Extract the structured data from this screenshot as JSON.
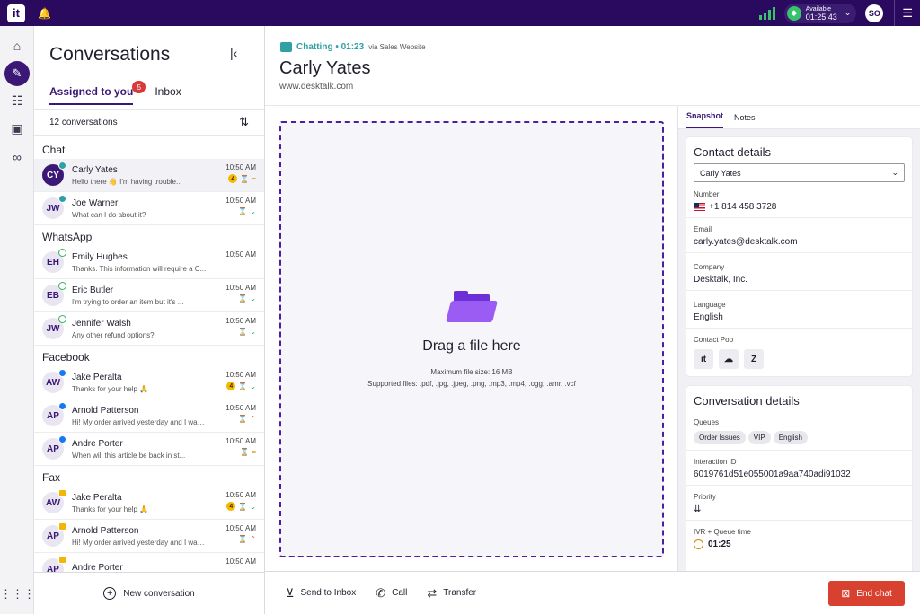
{
  "topbar": {
    "logo": "it",
    "bell_icon": "bell-icon",
    "status_label": "Available",
    "status_time": "01:25:43",
    "user_initials": "SO"
  },
  "rail": {
    "items": [
      "home-icon",
      "conversations-icon",
      "tasks-icon",
      "contacts-icon",
      "voicemail-icon"
    ],
    "apps_icon": "apps-grid-icon"
  },
  "conversations": {
    "title": "Conversations",
    "tabs": [
      {
        "label": "Assigned to you",
        "badge": "5"
      },
      {
        "label": "Inbox"
      }
    ],
    "count_label": "12 conversations",
    "groups": [
      {
        "name": "Chat",
        "items": [
          {
            "initials": "CY",
            "name": "Carly Yates",
            "message": "Hello there 👋 I'm having trouble...",
            "time": "10:50 AM",
            "count": "4",
            "priority": "medium",
            "channel": "chat",
            "active": true
          },
          {
            "initials": "JW",
            "name": "Joe Warner",
            "message": "What can I do about it?",
            "time": "10:50 AM",
            "priority": "low",
            "channel": "chat"
          }
        ]
      },
      {
        "name": "WhatsApp",
        "items": [
          {
            "initials": "EH",
            "name": "Emily Hughes",
            "message": "Thanks. This information will require a C...",
            "time": "10:50 AM",
            "channel": "whatsapp"
          },
          {
            "initials": "EB",
            "name": "Eric Butler",
            "message": "I'm trying to order an item but it's ...",
            "time": "10:50 AM",
            "priority": "low",
            "channel": "whatsapp"
          },
          {
            "initials": "JW",
            "name": "Jennifer Walsh",
            "message": "Any other refund options?",
            "time": "10:50 AM",
            "priority": "low",
            "channel": "whatsapp"
          }
        ]
      },
      {
        "name": "Facebook",
        "items": [
          {
            "initials": "AW",
            "name": "Jake Peralta",
            "message": "Thanks for your help 🙏",
            "time": "10:50 AM",
            "count": "4",
            "priority": "low",
            "channel": "facebook"
          },
          {
            "initials": "AP",
            "name": "Arnold Patterson",
            "message": "Hi! My order arrived yesterday and I was...",
            "time": "10:50 AM",
            "priority": "high",
            "channel": "facebook"
          },
          {
            "initials": "AP",
            "name": "Andre Porter",
            "message": "When will this article be back in st...",
            "time": "10:50 AM",
            "priority": "medium",
            "channel": "facebook"
          }
        ]
      },
      {
        "name": "Fax",
        "items": [
          {
            "initials": "AW",
            "name": "Jake Peralta",
            "message": "Thanks for your help 🙏",
            "time": "10:50 AM",
            "count": "4",
            "priority": "low",
            "channel": "fax"
          },
          {
            "initials": "AP",
            "name": "Arnold Patterson",
            "message": "Hi! My order arrived yesterday and I was...",
            "time": "10:50 AM",
            "priority": "high",
            "channel": "fax"
          },
          {
            "initials": "AP",
            "name": "Andre Porter",
            "message": "",
            "time": "10:50 AM",
            "channel": "fax"
          }
        ]
      }
    ],
    "new_conversation": "New conversation"
  },
  "chat": {
    "status": "Chatting • 01:23",
    "via": "via Sales Website",
    "contact_name": "Carly Yates",
    "contact_site": "www.desktalk.com"
  },
  "dropzone": {
    "title": "Drag a file here",
    "max_size": "Maximum file size: 16 MB",
    "supported": "Supported files: .pdf, .jpg, .jpeg, .png, .mp3, .mp4, .ogg, .amr, .vcf"
  },
  "details": {
    "tabs": [
      "Snapshot",
      "Notes"
    ],
    "contact": {
      "title": "Contact details",
      "selected": "Carly Yates",
      "number_label": "Number",
      "number": "+1 814 458 3728",
      "email_label": "Email",
      "email": "carly.yates@desktalk.com",
      "company_label": "Company",
      "company": "Desktalk, Inc.",
      "language_label": "Language",
      "language": "English",
      "contact_pop_label": "Contact Pop"
    },
    "conversation": {
      "title": "Conversation details",
      "queues_label": "Queues",
      "queues": [
        "Order Issues",
        "VIP",
        "English"
      ],
      "interaction_label": "Interaction ID",
      "interaction_id": "6019761d51e055001a9aa740adi91032",
      "priority_label": "Priority",
      "ivr_label": "IVR + Queue time",
      "ivr_time": "01:25"
    }
  },
  "actions": {
    "send_to_inbox": "Send to Inbox",
    "call": "Call",
    "transfer": "Transfer",
    "end_chat": "End chat"
  },
  "colors": {
    "brand": "#2a0a5e",
    "accent": "#3b1876",
    "chat_teal": "#2ea0a6",
    "end_chat": "#d8412f"
  }
}
